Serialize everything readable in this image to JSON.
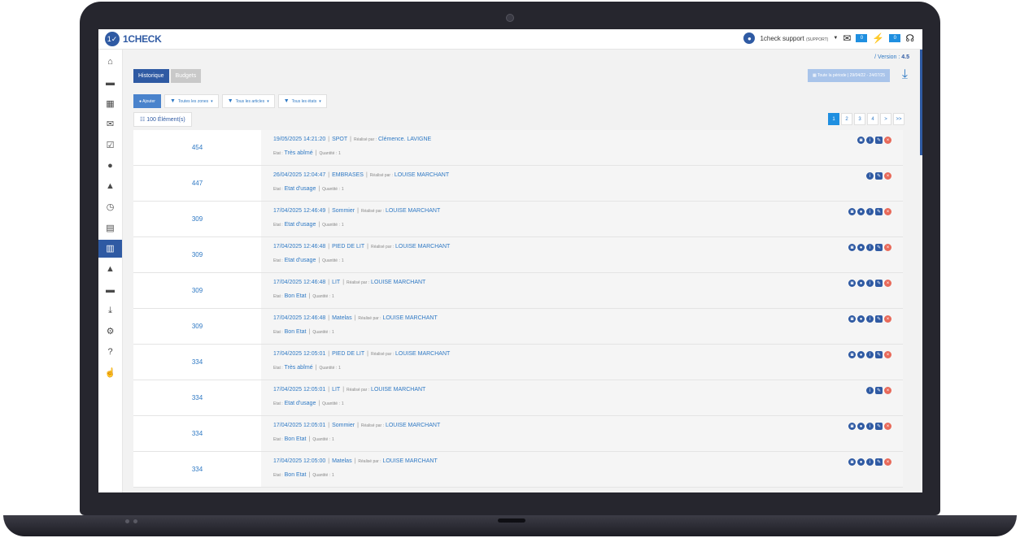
{
  "app": {
    "logo_mark": "1✓",
    "logo_text": "1CHECK",
    "user": "1check support",
    "user_role": "(SUPPORT)",
    "mail_count": "0",
    "alert_count": "0",
    "version_label": "/ Version :",
    "version_value": "4.5"
  },
  "icons": {
    "sidebar": [
      "⌂",
      "▬",
      "▦",
      "✉",
      "☑",
      "●",
      "▲",
      "◷",
      "▤",
      "▥",
      "▲",
      "▬",
      "⤓",
      "⚙",
      "?",
      "☝"
    ]
  },
  "tabs": [
    "Historique",
    "Budgets"
  ],
  "period": "▦ Toute la période  |  29/04/22 - 24/07/25",
  "filters": {
    "add": "● Ajouter",
    "items": [
      "Toutes les zones",
      "Tous les articles",
      "Tous les états"
    ]
  },
  "count_label": "☷ 100 Élément(s)",
  "pager": [
    "1",
    "2",
    "3",
    "4",
    ">",
    ">>"
  ],
  "labels": {
    "realise": "Réalisé par :",
    "etat": "Etat :",
    "quantite": "Quantité :"
  },
  "rows": [
    {
      "num": "454",
      "date": "19/05/2025 14:21:20",
      "article": "SPOT",
      "user": "Clémence. LAVIGNE",
      "etat": "Très abîmé",
      "qty": "1",
      "icons": [
        "cam",
        "info",
        "edit",
        "del"
      ]
    },
    {
      "num": "447",
      "date": "26/04/2025 12:04:47",
      "article": "EMBRASES",
      "user": "LOUISE MARCHANT",
      "etat": "Etat d'usage",
      "qty": "1",
      "icons": [
        "info",
        "edit",
        "del"
      ]
    },
    {
      "num": "309",
      "date": "17/04/2025 12:46:49",
      "article": "Sommier",
      "user": "LOUISE MARCHANT",
      "etat": "Etat d'usage",
      "qty": "1",
      "icons": [
        "cam",
        "chat",
        "info",
        "edit",
        "del"
      ]
    },
    {
      "num": "309",
      "date": "17/04/2025 12:46:48",
      "article": "PIED DE LIT",
      "user": "LOUISE MARCHANT",
      "etat": "Etat d'usage",
      "qty": "1",
      "icons": [
        "cam",
        "chat",
        "info",
        "edit",
        "del"
      ]
    },
    {
      "num": "309",
      "date": "17/04/2025 12:46:48",
      "article": "LIT",
      "user": "LOUISE MARCHANT",
      "etat": "Bon Etat",
      "qty": "1",
      "icons": [
        "cam",
        "chat",
        "info",
        "edit",
        "del"
      ]
    },
    {
      "num": "309",
      "date": "17/04/2025 12:46:48",
      "article": "Matelas",
      "user": "LOUISE MARCHANT",
      "etat": "Bon Etat",
      "qty": "1",
      "icons": [
        "cam",
        "chat",
        "info",
        "edit",
        "del"
      ]
    },
    {
      "num": "334",
      "date": "17/04/2025 12:05:01",
      "article": "PIED DE LIT",
      "user": "LOUISE MARCHANT",
      "etat": "Très abîmé",
      "qty": "1",
      "icons": [
        "cam",
        "chat",
        "info",
        "edit",
        "del"
      ]
    },
    {
      "num": "334",
      "date": "17/04/2025 12:05:01",
      "article": "LIT",
      "user": "LOUISE MARCHANT",
      "etat": "Etat d'usage",
      "qty": "1",
      "icons": [
        "info",
        "edit",
        "del"
      ]
    },
    {
      "num": "334",
      "date": "17/04/2025 12:05:01",
      "article": "Sommier",
      "user": "LOUISE MARCHANT",
      "etat": "Bon Etat",
      "qty": "1",
      "icons": [
        "cam",
        "chat",
        "info",
        "edit",
        "del"
      ]
    },
    {
      "num": "334",
      "date": "17/04/2025 12:05:00",
      "article": "Matelas",
      "user": "LOUISE MARCHANT",
      "etat": "Bon Etat",
      "qty": "1",
      "icons": [
        "cam",
        "chat",
        "info",
        "edit",
        "del"
      ]
    }
  ]
}
